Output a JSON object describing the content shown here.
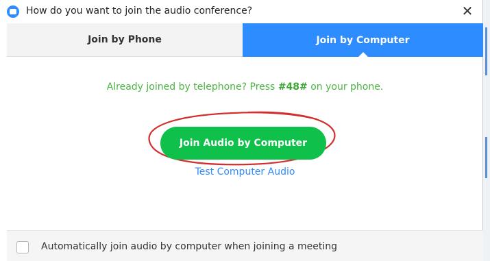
{
  "window": {
    "title": "How do you want to join the audio conference?",
    "close_glyph": "✕"
  },
  "tabs": [
    {
      "label": "Join by Phone",
      "selected": false
    },
    {
      "label": "Join by Computer",
      "selected": true
    }
  ],
  "info": {
    "prefix": "Already joined by telephone? Press ",
    "code": "#48#",
    "suffix": " on your phone."
  },
  "join_button": {
    "label": "Join Audio by Computer"
  },
  "test_link": {
    "label": "Test Computer Audio"
  },
  "footer": {
    "checkbox_label": "Automatically join audio by computer when joining a meeting",
    "checked": false
  },
  "colors": {
    "accent_blue": "#2d8cff",
    "join_green": "#0fc04a",
    "info_green": "#4bb543",
    "annotation_red": "#d32f2f"
  },
  "icons": {
    "app": "zoom-app-icon",
    "close": "close-icon"
  }
}
